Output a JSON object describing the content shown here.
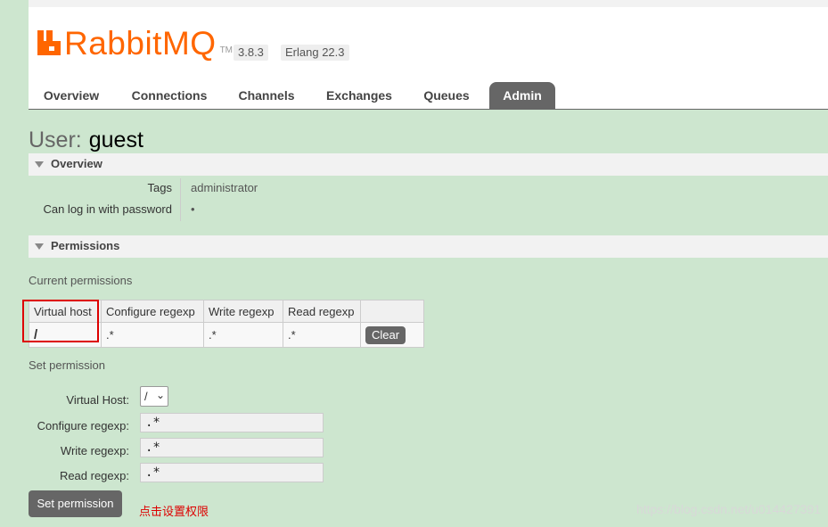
{
  "brand": {
    "name": "RabbitMQ",
    "tm": "TM",
    "version": "3.8.3",
    "erlang": "Erlang 22.3",
    "accent": "#ff6600"
  },
  "tabs": [
    {
      "label": "Overview"
    },
    {
      "label": "Connections"
    },
    {
      "label": "Channels"
    },
    {
      "label": "Exchanges"
    },
    {
      "label": "Queues"
    },
    {
      "label": "Admin",
      "active": true
    }
  ],
  "page": {
    "title_prefix": "User:",
    "title_name": "guest"
  },
  "overview": {
    "heading": "Overview",
    "tags_label": "Tags",
    "tags_value": "administrator",
    "login_label": "Can log in with password",
    "login_value": "•"
  },
  "permissions": {
    "heading": "Permissions",
    "current_label": "Current permissions",
    "columns": [
      "Virtual host",
      "Configure regexp",
      "Write regexp",
      "Read regexp"
    ],
    "rows": [
      {
        "vhost": "/",
        "configure": ".*",
        "write": ".*",
        "read": ".*",
        "action": "Clear"
      }
    ]
  },
  "set_permission": {
    "heading": "Set permission",
    "vhost_label": "Virtual Host:",
    "vhost_value": "/",
    "configure_label": "Configure regexp:",
    "configure_value": ".*",
    "write_label": "Write regexp:",
    "write_value": ".*",
    "read_label": "Read regexp:",
    "read_value": ".*",
    "submit_label": "Set permission"
  },
  "annotation": "点击设置权限",
  "watermark": "https://blog.csdn.net/u014427391"
}
